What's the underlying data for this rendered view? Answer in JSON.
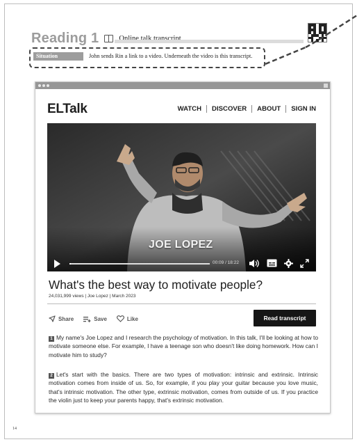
{
  "reading": {
    "title": "Reading 1",
    "subtitle": "Online talk transcript",
    "situation_label": "Situation",
    "situation_text": "John sends Rin a link to a video. Underneath the video is this transcript."
  },
  "site": {
    "logo": "ELTalk",
    "nav": [
      "WATCH",
      "DISCOVER",
      "ABOUT",
      "SIGN IN"
    ]
  },
  "video": {
    "speaker_name": "JOE LOPEZ",
    "time": "00:09 / 18:22",
    "progress_fraction": 0.008
  },
  "talk": {
    "title": "What's the best way to motivate people?",
    "meta": "24,031,999 views | Joe Lopez | March 2023",
    "actions": {
      "share": "Share",
      "save": "Save",
      "like": "Like"
    },
    "transcript_button": "Read transcript"
  },
  "transcript": {
    "p1_num": "1",
    "p1": "My name's Joe Lopez and I research the psychology of motivation. In this talk, I'll be looking at how to motivate someone else. For example, I have a teenage son who doesn't like doing homework. How can I motivate him to study?",
    "p2_num": "2",
    "p2": "Let's start with the basics. There are two types of motivation: intrinsic and extrinsic. Intrinsic motivation comes from inside of us. So, for example, if you play your guitar because you love music, that's intrinsic motivation. The other type, extrinsic motivation, comes from outside of us. If you practice the violin just to keep your parents happy, that's extrinsic motivation."
  },
  "page_number": "14"
}
